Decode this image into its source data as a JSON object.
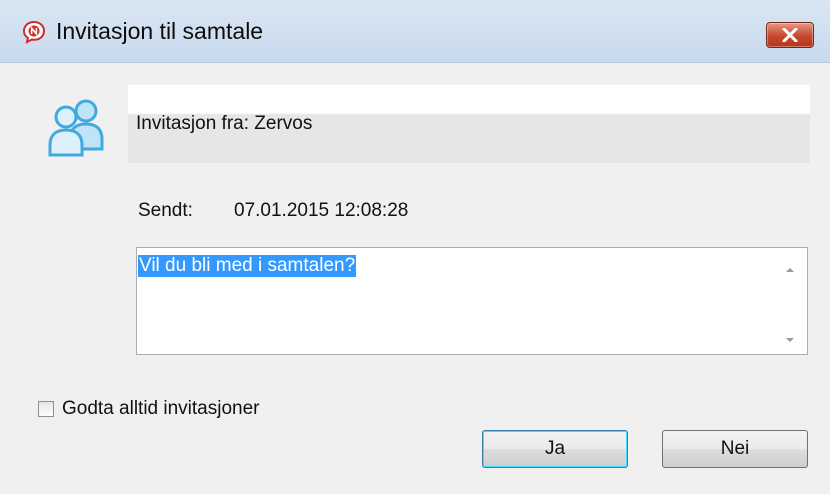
{
  "window": {
    "title": "Invitasjon til samtale",
    "icon": "app-logo-icon",
    "close_icon": "close-icon"
  },
  "invitation": {
    "from_text": "Invitasjon fra: Zervos",
    "icon": "users-icon"
  },
  "sent": {
    "label": "Sendt:",
    "value": "07.01.2015 12:08:28"
  },
  "message": {
    "text": "Vil du bli med i samtalen?",
    "selected": true
  },
  "always_accept": {
    "label": "Godta alltid invitasjoner",
    "checked": false
  },
  "buttons": {
    "yes_label": "Ja",
    "no_label": "Nei"
  },
  "colors": {
    "selection": "#3399ff",
    "close_button": "#c4492d",
    "users_icon": "#3fa9e0"
  }
}
